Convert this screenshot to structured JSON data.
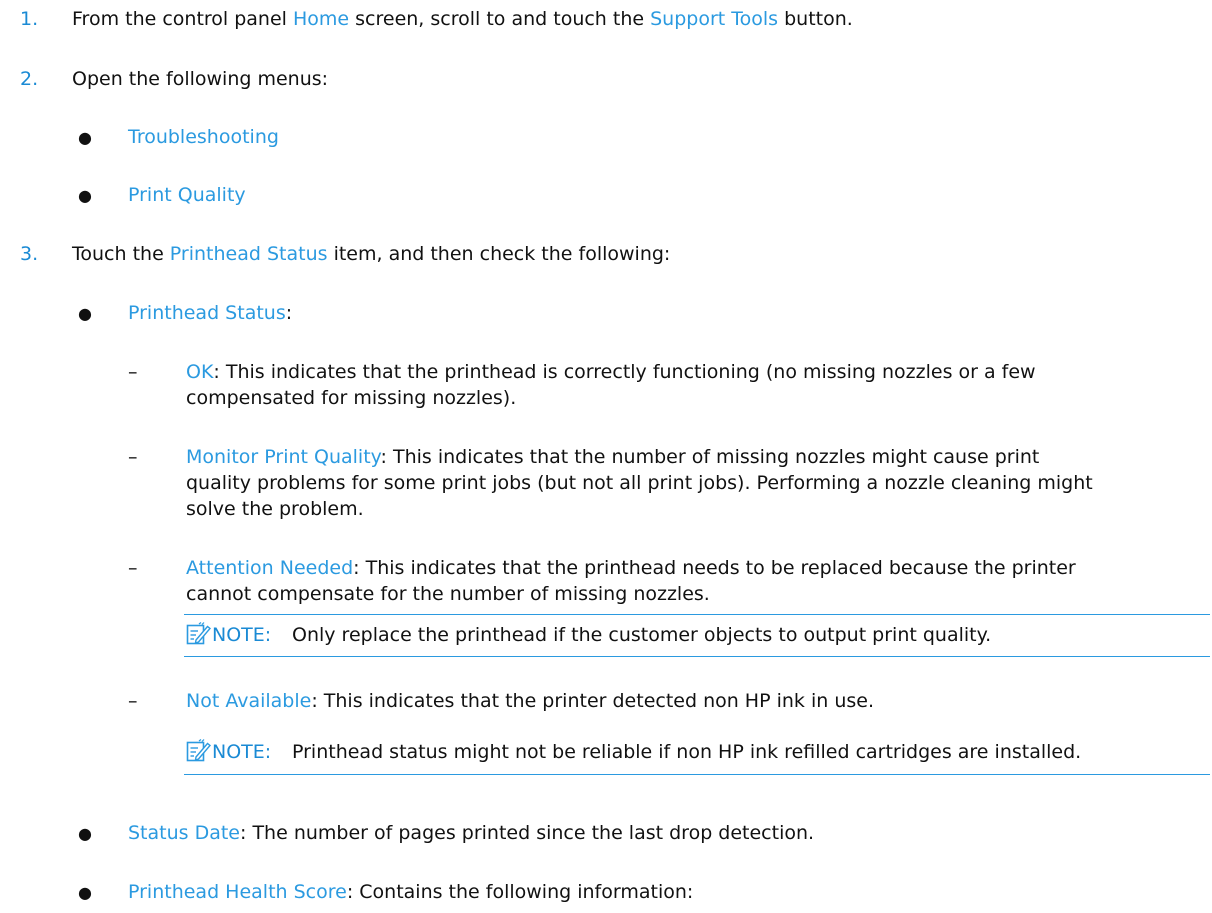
{
  "colors": {
    "accent": "#2b9ae0",
    "text": "#111111"
  },
  "steps": [
    {
      "number": "1.",
      "parts": [
        "From the control panel ",
        "Home",
        " screen, scroll to and touch the ",
        "Support Tools",
        " button."
      ]
    },
    {
      "number": "2.",
      "text": "Open the following menus:",
      "bullets": [
        "Troubleshooting",
        "Print Quality"
      ]
    },
    {
      "number": "3.",
      "parts": [
        "Touch the ",
        "Printhead Status",
        " item, and then check the following:"
      ]
    }
  ],
  "printhead_status": {
    "label": "Printhead Status",
    "colon": ":",
    "items": [
      {
        "term": "OK",
        "line1": ": This indicates that the printhead is correctly functioning (no missing nozzles or a few",
        "line2": "compensated for missing nozzles)."
      },
      {
        "term": "Monitor Print Quality",
        "line1": ": This indicates that the number of missing nozzles might cause print",
        "line2": "quality problems for some print jobs (but not all print jobs). Performing a nozzle cleaning might",
        "line3": "solve the problem."
      },
      {
        "term": "Attention Needed",
        "line1": ": This indicates that the printhead needs to be replaced because the printer",
        "line2": "cannot compensate for the number of missing nozzles."
      },
      {
        "term": "Not Available",
        "line1": ": This indicates that the printer detected non HP ink in use."
      }
    ]
  },
  "notes": [
    {
      "label": "NOTE:",
      "text": "Only replace the printhead if the customer objects to output print quality."
    },
    {
      "label": "NOTE:",
      "text": "Printhead status might not be reliable if non HP ink refilled cartridges are installed."
    }
  ],
  "more_bullets": [
    {
      "term": "Status Date",
      "rest": ": The number of pages printed since the last drop detection."
    },
    {
      "term": "Printhead Health Score",
      "rest": ": Contains the following information:"
    }
  ],
  "glyphs": {
    "bullet": "●",
    "dash": "–"
  },
  "icons": {
    "note": "note-pencil-icon"
  }
}
